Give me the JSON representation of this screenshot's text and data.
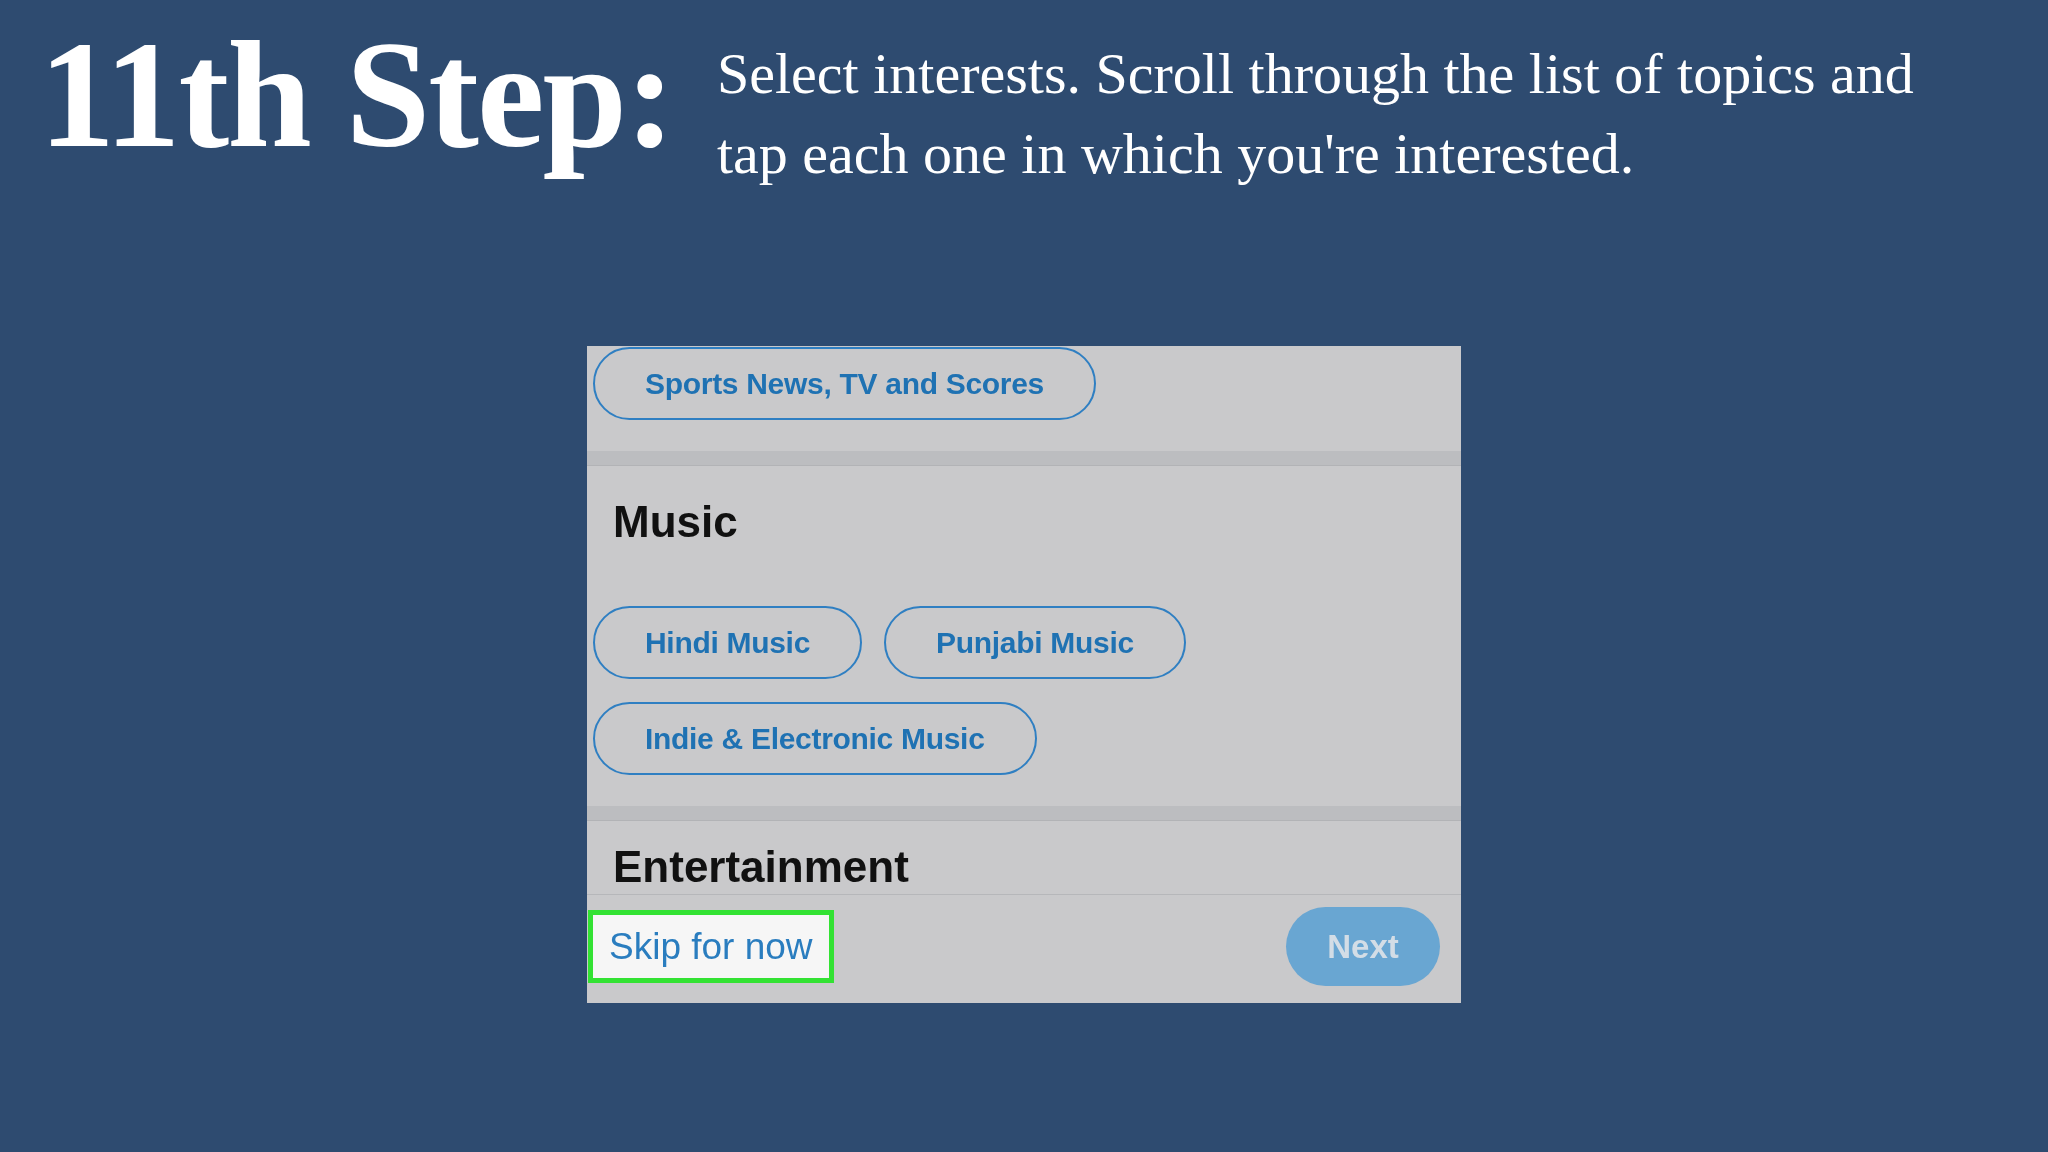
{
  "header": {
    "title": "11th Step:",
    "instructions": [
      "Select interests. Scroll through the list of topics and",
      "tap each one in which you're interested."
    ]
  },
  "app_screen": {
    "sections": [
      {
        "topics": [
          {
            "label": "Sports News, TV and Scores",
            "selected": false
          }
        ]
      },
      {
        "title": "Music",
        "topics": [
          {
            "label": "Hindi Music",
            "selected": false
          },
          {
            "label": "Punjabi Music",
            "selected": false
          },
          {
            "label": "Indie & Electronic Music",
            "selected": false
          }
        ]
      },
      {
        "title": "Entertainment"
      }
    ],
    "footer": {
      "skip": {
        "label": "Skip for now",
        "highlighted": true
      },
      "next": {
        "label": "Next",
        "disabled": true
      }
    }
  }
}
